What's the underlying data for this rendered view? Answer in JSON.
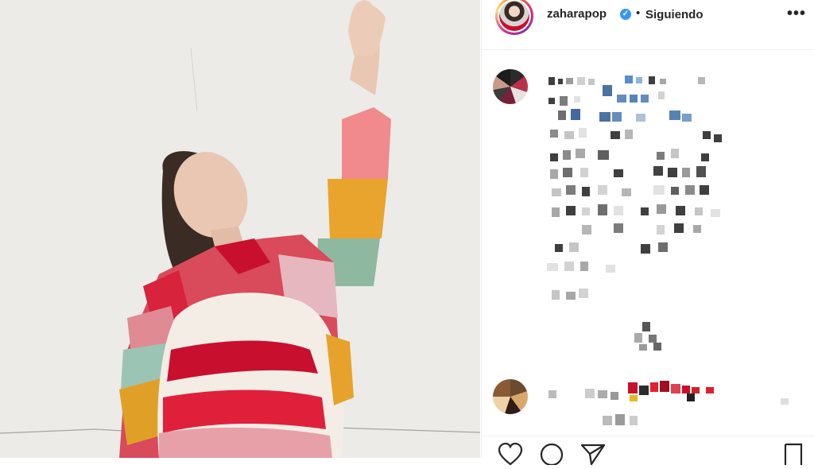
{
  "post": {
    "username": "zaharapop",
    "verified": true,
    "separator": "•",
    "follow_status": "Siguiendo",
    "more_options": "•••"
  },
  "icons": {
    "verified": "verified-badge-icon",
    "more": "more-options-icon",
    "like": "heart-icon",
    "comment": "comment-icon",
    "share": "share-icon",
    "save": "bookmark-icon"
  },
  "colors": {
    "accent": "#3897f0",
    "text": "#262626",
    "divider": "#efefef"
  }
}
